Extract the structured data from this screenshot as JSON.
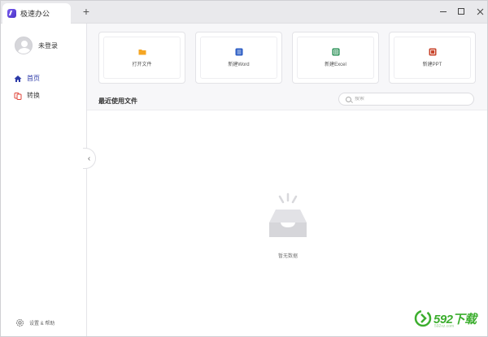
{
  "tab": {
    "label": "极速办公"
  },
  "titlebar": {
    "new_tab": "+"
  },
  "sidebar": {
    "user_name": "未登录",
    "items": [
      {
        "label": "首页",
        "icon": "home-icon",
        "active": true
      },
      {
        "label": "转换",
        "icon": "convert-icon",
        "active": false
      }
    ],
    "settings_label": "设置 & 帮助"
  },
  "cards": [
    {
      "label": "打开文件",
      "icon": "folder-icon",
      "color": "#f5a623"
    },
    {
      "label": "新建Word",
      "icon": "word-icon",
      "color": "#2b5cc4"
    },
    {
      "label": "新建Excel",
      "icon": "excel-icon",
      "color": "#1e8a4c"
    },
    {
      "label": "新建PPT",
      "icon": "ppt-icon",
      "color": "#c8452c"
    }
  ],
  "recent": {
    "title": "最近使用文件"
  },
  "search": {
    "placeholder": "搜索"
  },
  "empty": {
    "label": "暂无数据"
  },
  "watermark": {
    "text": "592下载",
    "sub": "592xz.com"
  },
  "colors": {
    "accent": "#2c3aa8",
    "watermark": "#3cae2e"
  }
}
